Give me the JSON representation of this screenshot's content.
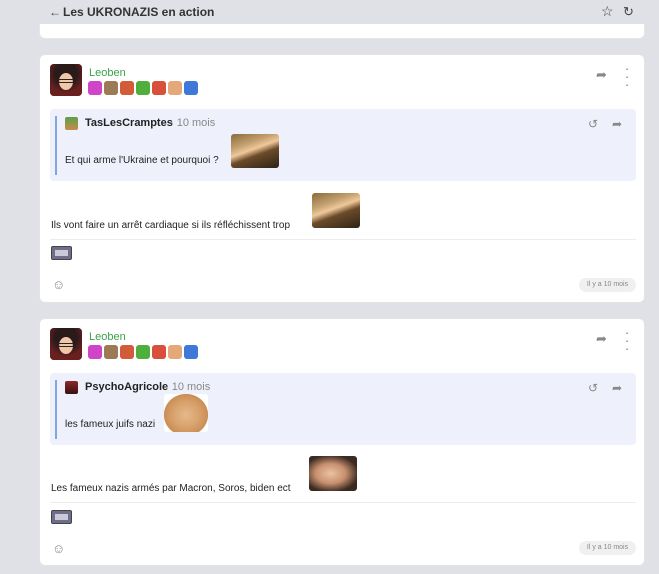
{
  "header": {
    "back_icon": "arrow-left-icon",
    "title": "Les UKRONAZIS en action",
    "star_icon": "star-icon",
    "refresh_icon": "refresh-icon"
  },
  "posts": [
    {
      "author": "Leoben",
      "author_color": "#3aa24a",
      "badges": [
        "#d045c8",
        "#9c7a55",
        "#d25b3a",
        "#4fae3c",
        "#d8503c",
        "#e5a87a",
        "#3e78d8"
      ],
      "quote": {
        "author": "TasLesCramptes",
        "date": "· 10 mois",
        "text": "Et qui arme l'Ukraine et pourquoi ?"
      },
      "message": "Ils vont faire un arrêt cardiaque si ils réfléchissent trop",
      "time": "Il y a 10 mois"
    },
    {
      "author": "Leoben",
      "author_color": "#3aa24a",
      "badges": [
        "#d045c8",
        "#9c7a55",
        "#d25b3a",
        "#4fae3c",
        "#d8503c",
        "#e5a87a",
        "#3e78d8"
      ],
      "quote": {
        "author": "PsychoAgricole",
        "date": "· 10 mois",
        "text": "les fameux juifs nazi"
      },
      "message": "Les fameux nazis armés par Macron, Soros, biden ect",
      "time": "Il y a 10 mois"
    }
  ]
}
